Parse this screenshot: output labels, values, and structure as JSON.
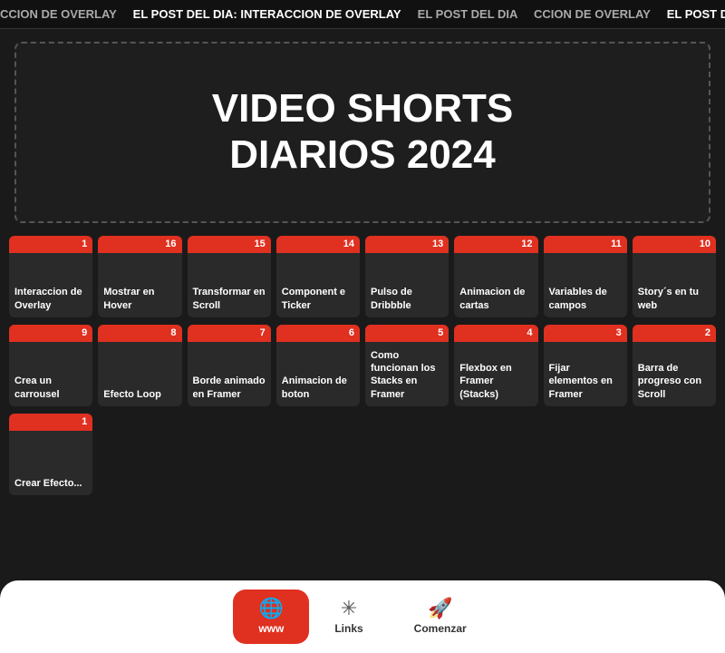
{
  "ticker": {
    "text1": "CCION DE OVERLAY",
    "text2": "EL POST DEL DIA: INTERACCION DE OVERLAY",
    "text3": "EL POST DEL DIA"
  },
  "hero": {
    "title_line1": "VIDEO SHORTS",
    "title_line2": "DIARIOS 2024"
  },
  "grid_row1": [
    {
      "badge": "1",
      "label": "Interaccion de Overlay"
    },
    {
      "badge": "16",
      "label": "Mostrar en Hover"
    },
    {
      "badge": "15",
      "label": "Transformar en Scroll"
    },
    {
      "badge": "14",
      "label": "Component e Ticker"
    },
    {
      "badge": "13",
      "label": "Pulso de Dribbble"
    },
    {
      "badge": "12",
      "label": "Animacion de cartas"
    },
    {
      "badge": "11",
      "label": "Variables de campos"
    },
    {
      "badge": "10",
      "label": "Story´s en tu web"
    }
  ],
  "grid_row2": [
    {
      "badge": "9",
      "label": "Crea un carrousel"
    },
    {
      "badge": "8",
      "label": "Efecto Loop"
    },
    {
      "badge": "7",
      "label": "Borde animado en Framer"
    },
    {
      "badge": "6",
      "label": "Animacion de boton"
    },
    {
      "badge": "5",
      "label": "Como funcionan los Stacks en Framer"
    },
    {
      "badge": "4",
      "label": "Flexbox en Framer (Stacks)"
    },
    {
      "badge": "3",
      "label": "Fijar elementos en Framer"
    },
    {
      "badge": "2",
      "label": "Barra de progreso con Scroll"
    }
  ],
  "grid_row3": [
    {
      "badge": "1",
      "label": "Crear Efecto..."
    }
  ],
  "bottom_nav": {
    "buttons": [
      {
        "id": "www",
        "icon": "🌐",
        "label": "www",
        "active": true
      },
      {
        "id": "links",
        "icon": "✳",
        "label": "Links",
        "active": false
      },
      {
        "id": "comenzar",
        "icon": "🚀",
        "label": "Comenzar",
        "active": false
      }
    ]
  }
}
